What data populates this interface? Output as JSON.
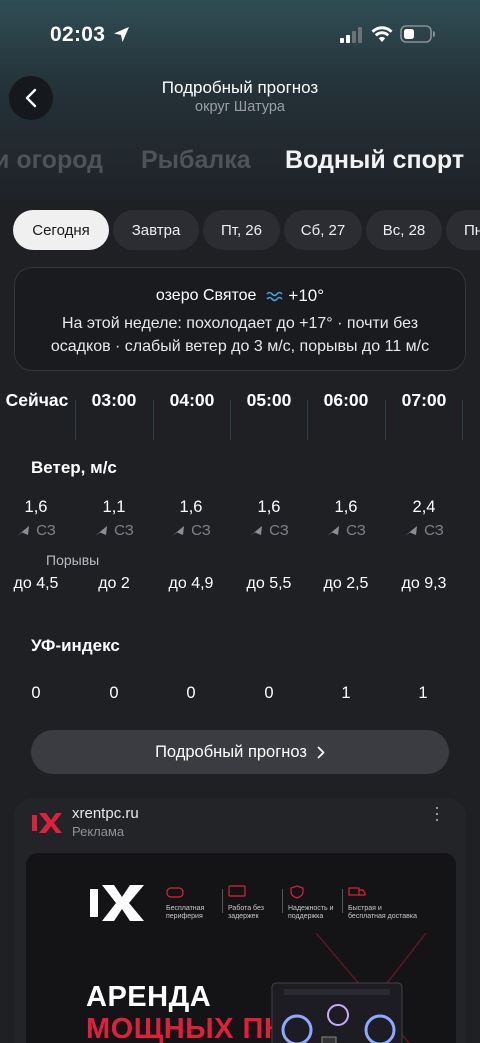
{
  "status": {
    "time": "02:03"
  },
  "header": {
    "title": "Подробный прогноз",
    "subtitle": "округ Шатура"
  },
  "sport_tabs": [
    "и огород",
    "Рыбалка",
    "Водный спорт"
  ],
  "day_tabs": [
    "Сегодня",
    "Завтра",
    "Пт, 26",
    "Сб, 27",
    "Вс, 28",
    "Пн"
  ],
  "card": {
    "lake": "озеро Святое",
    "water_temp": "+10°",
    "text": "На этой неделе: похолодает до +17° · почти без осадков · слабый ветер до 3 м/с, порывы до 11 м/с"
  },
  "hours": [
    "Сейчас",
    "03:00",
    "04:00",
    "05:00",
    "06:00",
    "07:00"
  ],
  "wind": {
    "title": "Ветер, м/с",
    "speeds": [
      "1,6",
      "1,1",
      "1,6",
      "1,6",
      "1,6",
      "2,4"
    ],
    "directions": [
      "СЗ",
      "СЗ",
      "СЗ",
      "СЗ",
      "СЗ",
      "СЗ"
    ],
    "gust_label": "Порывы",
    "gusts": [
      "до 4,5",
      "до 2",
      "до 4,9",
      "до 5,5",
      "до 2,5",
      "до 9,3"
    ]
  },
  "uv": {
    "title": "УФ-индекс",
    "values": [
      "0",
      "0",
      "0",
      "0",
      "1",
      "1"
    ]
  },
  "detail_button": {
    "label": "Подробный прогноз"
  },
  "ad": {
    "domain": "xrentpc.ru",
    "label": "Реклама",
    "features": [
      "Бесплатная периферия",
      "Работа без задержек",
      "Надежность и поддержка",
      "Быстрая и бесплатная доставка"
    ],
    "headline1": "АРЕНДА",
    "headline2": "МОЩНЫХ ПК"
  },
  "colors": {
    "accent_red": "#e0203b",
    "background": "#1f2024",
    "water_icon": "#4aa3e0"
  }
}
